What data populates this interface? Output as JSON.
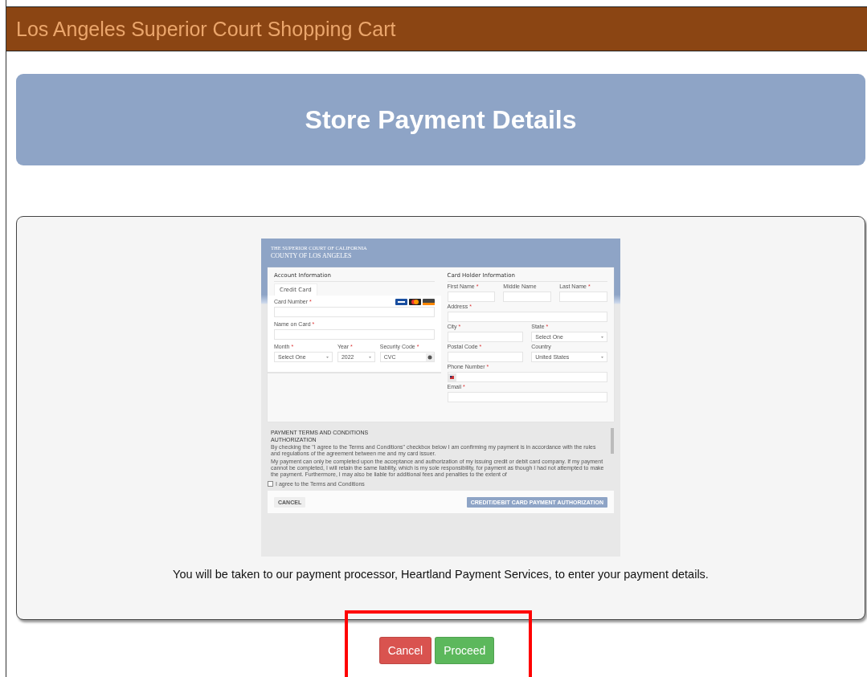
{
  "top_bar": {
    "title": "Los Angeles Superior Court Shopping Cart"
  },
  "header": {
    "title": "Store Payment Details"
  },
  "preview": {
    "court": {
      "line1": "THE SUPERIOR COURT OF CALIFORNIA",
      "line2": "COUNTY OF LOS ANGELES"
    },
    "account": {
      "title": "Account Information",
      "tabs": [
        {
          "label": "Credit Card",
          "selected": true
        }
      ],
      "card_number": {
        "label": "Card Number",
        "required_mark": "*"
      },
      "name_on_card": {
        "label": "Name on Card",
        "required_mark": "*"
      },
      "month": {
        "label": "Month",
        "required_mark": "*",
        "value": "Select One"
      },
      "year": {
        "label": "Year",
        "required_mark": "*",
        "value": "2022"
      },
      "security_code": {
        "label": "Security Code",
        "required_mark": "*",
        "placeholder": "CVC"
      }
    },
    "card_holder": {
      "title": "Card Holder Information",
      "rows": [
        {
          "fields": [
            {
              "label": "First Name",
              "required_mark": "*",
              "kind": "input"
            },
            {
              "label": "Middle Name",
              "kind": "input"
            },
            {
              "label": "Last Name",
              "required_mark": "*",
              "kind": "input"
            }
          ]
        },
        {
          "fields": [
            {
              "label": "Address",
              "required_mark": "*",
              "kind": "input"
            }
          ]
        },
        {
          "fields": [
            {
              "label": "City",
              "required_mark": "*",
              "kind": "input"
            },
            {
              "label": "State",
              "required_mark": "*",
              "kind": "select",
              "value": "Select One"
            }
          ]
        },
        {
          "fields": [
            {
              "label": "Postal Code",
              "required_mark": "*",
              "kind": "input"
            },
            {
              "label": "Country",
              "kind": "select",
              "value": "United States"
            }
          ]
        },
        {
          "fields": [
            {
              "label": "Phone Number",
              "required_mark": "*",
              "kind": "phone"
            }
          ]
        },
        {
          "fields": [
            {
              "label": "Email",
              "required_mark": "*",
              "kind": "input"
            }
          ]
        }
      ]
    },
    "terms": {
      "heading": "PAYMENT TERMS AND CONDITIONS",
      "subheading": "AUTHORIZATION",
      "paragraphs": [
        "By checking the \"I agree to the Terms and Conditions\" checkbox below I am confirming my payment is in accordance with the rules and regulations of the agreement between me and my card issuer.",
        "My payment can only be completed upon the acceptance and authorization of my issuing credit or debit card company. If my payment cannot be completed, I will retain the same liability, which is my sole responsibility, for payment as though I had not attempted to make the payment. Furthermore, I may also be liable for additional fees and penalties to the extent of"
      ],
      "agree": {
        "label": "I agree to the Terms and Conditions",
        "checked": false
      }
    },
    "footer": {
      "cancel": "CANCEL",
      "submit": "CREDIT/DEBIT CARD PAYMENT AUTHORIZATION"
    }
  },
  "caption": "You will be taken to our payment processor, Heartland Payment Services, to enter your payment details.",
  "buttons": [
    {
      "label": "Cancel",
      "kind": "danger"
    },
    {
      "label": "Proceed",
      "kind": "success"
    }
  ],
  "highlight": {
    "color": "#ff0000"
  }
}
